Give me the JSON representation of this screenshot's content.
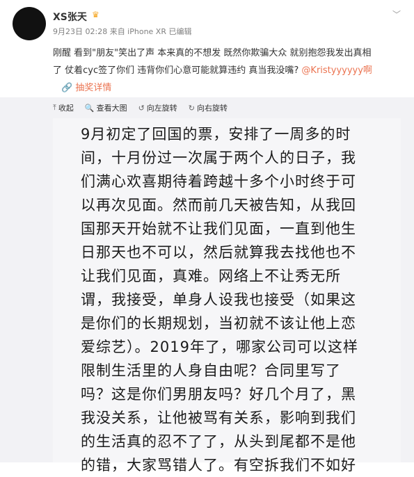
{
  "post": {
    "username": "XS张天",
    "badge_icon": "vip-crown-icon",
    "meta": "9月23日 02:28 来自 iPhone XR   已编辑",
    "text_line1": "刚醒 看到\"朋友\"笑出了声 本来真的不想发 既然你欺骗大众 就别抱怨我发出真相",
    "text_line2a": "了 仗着cyc签了你们 违背你们心意可能就算违约 真当我没嘴? ",
    "mention": "@Kristyyyyyy啊",
    "full_text_label": "抽奖详情"
  },
  "toolbar": {
    "collapse": "收起",
    "view_large": "查看大图",
    "rotate_left": "向左旋转",
    "rotate_right": "向右旋转"
  },
  "image_text": [
    "9月初定了回国的票，安排了一周多的时",
    "间，十月份过一次属于两个人的日子，我",
    "们满心欢喜期待着跨越十多个小时终于可",
    "以再次见面。然而前几天被告知，从我回",
    "国那天开始就不让我们见面，一直到他生",
    "日那天也不可以，然后就算我去找他也不",
    "让我们见面，真难。网络上不让秀无所",
    "谓，我接受，单身人设我也接受（如果这",
    "是你们的长期规划，当初就不该让他上恋",
    "爱综艺）。2019年了，哪家公司可以这样",
    "限制生活里的人身自由呢？合同里写了",
    "吗？这是你们男朋友吗？好几个月了，黑",
    "我没关系，让他被骂有关系，影响到我们",
    "的生活真的忍不了了，从头到尾都不是他",
    "的错，大家骂错人了。有空拆我们不如好"
  ]
}
